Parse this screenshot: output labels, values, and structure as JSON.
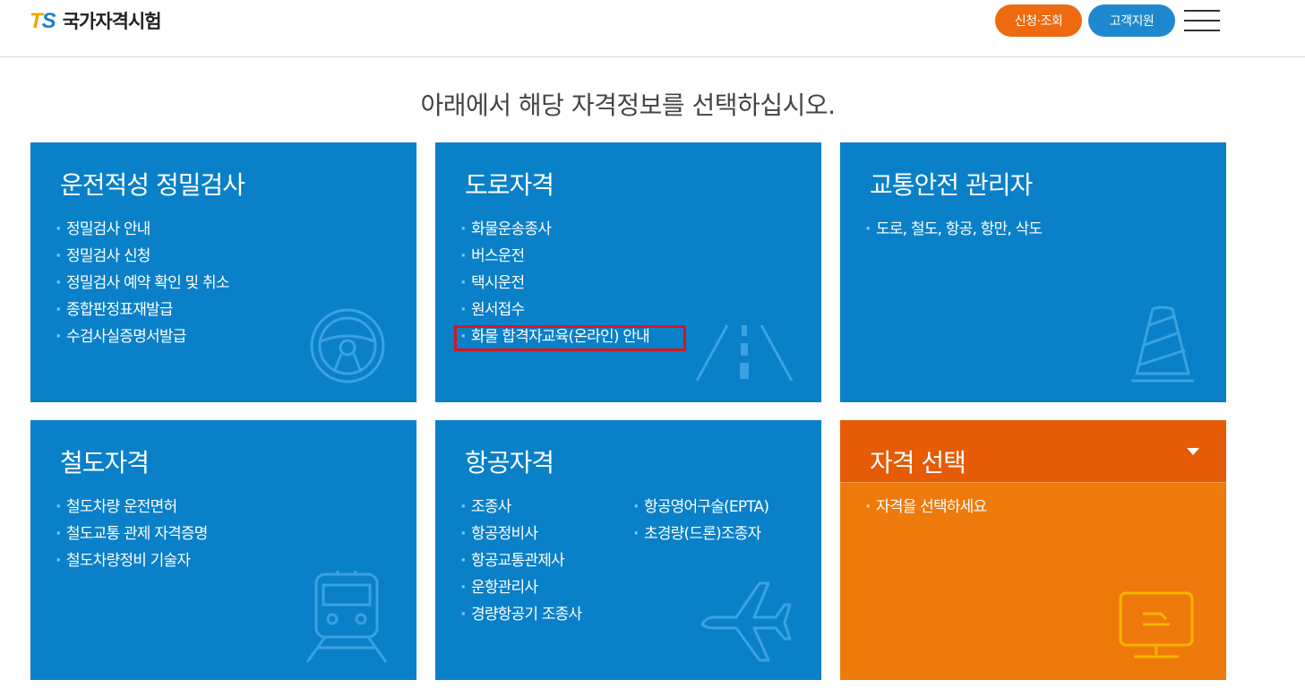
{
  "header": {
    "logo_mark_t": "T",
    "logo_mark_s": "S",
    "logo_text": "국가자격시험",
    "apply_label": "신청·조회",
    "support_label": "고객지원",
    "menu_icon": "hamburger-menu-icon"
  },
  "page_title": "아래에서 해당 자격정보를 선택하십시오.",
  "cards": {
    "aptitude": {
      "title": "운전적성 정밀검사",
      "items": [
        "정밀검사 안내",
        "정밀검사 신청",
        "정밀검사 예약 확인 및 취소",
        "종합판정표재발급",
        "수검사실증명서발급"
      ],
      "icon": "steering-wheel-icon"
    },
    "road": {
      "title": "도로자격",
      "items": [
        "화물운송종사",
        "버스운전",
        "택시운전",
        "원서접수",
        "화물 합격자교육(온라인) 안내"
      ],
      "icon": "road-icon"
    },
    "safety": {
      "title": "교통안전 관리자",
      "items": [
        "도로, 철도, 항공, 항만, 삭도"
      ],
      "icon": "traffic-cone-icon"
    },
    "rail": {
      "title": "철도자격",
      "items": [
        "철도차량 운전면허",
        "철도교통 관제 자격증명",
        "철도차량정비 기술자"
      ],
      "icon": "train-icon"
    },
    "aviation": {
      "title": "항공자격",
      "items_left": [
        "조종사",
        "항공정비사",
        "항공교통관제사",
        "운항관리사",
        "경량항공기 조종사"
      ],
      "items_right": [
        "항공영어구술(EPTA)",
        "초경량(드론)조종자"
      ],
      "icon": "airplane-icon"
    },
    "select": {
      "title": "자격 선택",
      "items": [
        "자격을 선택하세요"
      ],
      "icon": "monitor-icon"
    }
  },
  "colors": {
    "card_blue": "#0a80c8",
    "card_orange": "#ee7a0c",
    "select_head": "#e65b05",
    "apply_btn": "#ee6a10",
    "support_btn": "#1e88cf",
    "highlight": "#d9141d"
  }
}
